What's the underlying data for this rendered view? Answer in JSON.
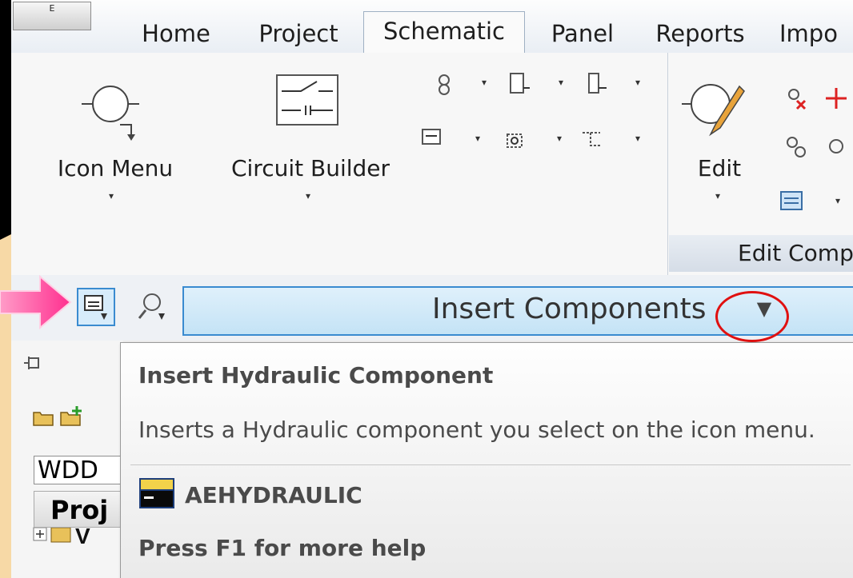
{
  "app_menu": {
    "label": "E"
  },
  "tabs": [
    {
      "label": "Home",
      "active": false
    },
    {
      "label": "Project",
      "active": false
    },
    {
      "label": "Schematic",
      "active": true
    },
    {
      "label": "Panel",
      "active": false
    },
    {
      "label": "Reports",
      "active": false
    },
    {
      "label": "Impo",
      "active": false
    }
  ],
  "ribbon": {
    "icon_menu_label": "Icon Menu",
    "circuit_builder_label": "Circuit Builder",
    "edit_label": "Edit",
    "edit_panel_title": "Edit Comp",
    "dropdown_glyph": "▾"
  },
  "palette": {
    "title": "Insert Components",
    "dropdown_glyph": "▼"
  },
  "left_panel": {
    "project_selector_value": "WDD",
    "project_header": "Proj"
  },
  "tooltip": {
    "title": "Insert Hydraulic Component",
    "description": "Inserts a Hydraulic component you select on the icon menu.",
    "command_name": "AEHYDRAULIC",
    "help": "Press F1 for more help"
  },
  "colors": {
    "accent_blue": "#3a8bd0",
    "highlight_red": "#e01010",
    "arrow_pink": "#ff4fa3"
  }
}
